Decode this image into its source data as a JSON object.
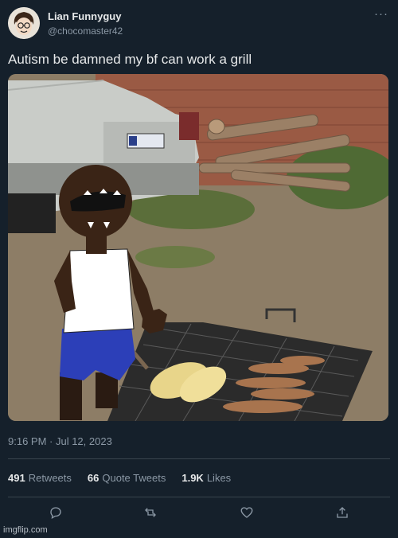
{
  "user": {
    "display_name": "Lian Funnyguy",
    "handle": "@chocomaster42"
  },
  "more_icon": "more-horizontal-icon",
  "tweet": {
    "text": "Autism be damned my bf can work a grill",
    "timestamp": "9:16 PM · Jul 12, 2023"
  },
  "stats": {
    "retweets_count": "491",
    "retweets_label": "Retweets",
    "quotes_count": "66",
    "quotes_label": "Quote Tweets",
    "likes_count": "1.9K",
    "likes_label": "Likes"
  },
  "actions": [
    "reply-icon",
    "retweet-icon",
    "like-icon",
    "share-icon"
  ],
  "watermark": "imgflip.com",
  "colors": {
    "background": "#15202b",
    "text": "#e7e9ea",
    "muted": "#8b98a5",
    "divider": "#38444d"
  }
}
